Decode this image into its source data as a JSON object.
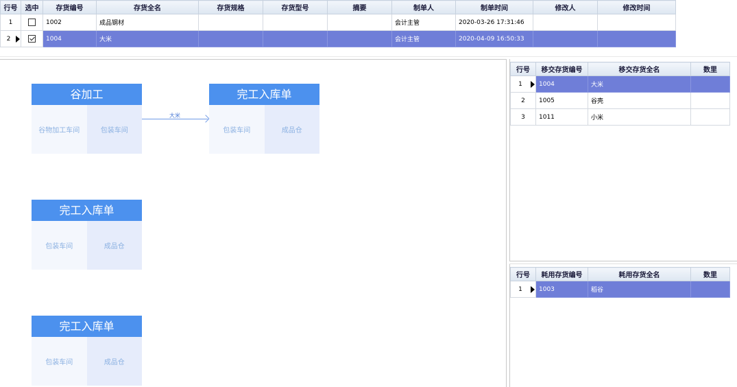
{
  "top_table": {
    "headers": [
      "行号",
      "选中",
      "存货编号",
      "存货全名",
      "存货规格",
      "存货型号",
      "摘要",
      "制单人",
      "制单时间",
      "修改人",
      "修改时间"
    ],
    "rows": [
      {
        "row_no": "1",
        "checked": false,
        "code": "1002",
        "name": "成品钢材",
        "spec": "",
        "model": "",
        "summary": "",
        "maker": "会计主管",
        "make_time": "2020-03-26 17:31:46",
        "modifier": "",
        "modify_time": ""
      },
      {
        "row_no": "2",
        "checked": true,
        "code": "1004",
        "name": "大米",
        "spec": "",
        "model": "",
        "summary": "",
        "maker": "会计主管",
        "make_time": "2020-04-09 16:50:33",
        "modifier": "",
        "modify_time": ""
      }
    ]
  },
  "flow": {
    "cards": [
      {
        "title": "谷加工",
        "left": "谷物加工车间",
        "right": "包装车间"
      },
      {
        "title": "完工入库单",
        "left": "包装车间",
        "right": "成品仓"
      },
      {
        "title": "完工入库单",
        "left": "包装车间",
        "right": "成品仓"
      },
      {
        "title": "完工入库单",
        "left": "包装车间",
        "right": "成品仓"
      }
    ],
    "arrow_label": "大米"
  },
  "transfer_table": {
    "headers": [
      "行号",
      "移交存货编号",
      "移交存货全名",
      "数里"
    ],
    "rows": [
      {
        "row_no": "1",
        "code": "1004",
        "name": "大米",
        "qty": ""
      },
      {
        "row_no": "2",
        "code": "1005",
        "name": "谷壳",
        "qty": ""
      },
      {
        "row_no": "3",
        "code": "1011",
        "name": "小米",
        "qty": ""
      }
    ]
  },
  "consume_table": {
    "headers": [
      "行号",
      "耗用存货编号",
      "耗用存货全名",
      "数里"
    ],
    "rows": [
      {
        "row_no": "1",
        "code": "1003",
        "name": "稻谷",
        "qty": ""
      }
    ]
  },
  "colors": {
    "card_header": "#4c91ee",
    "selected_row": "#6f7ed8",
    "card_text": "#8db2e2"
  }
}
